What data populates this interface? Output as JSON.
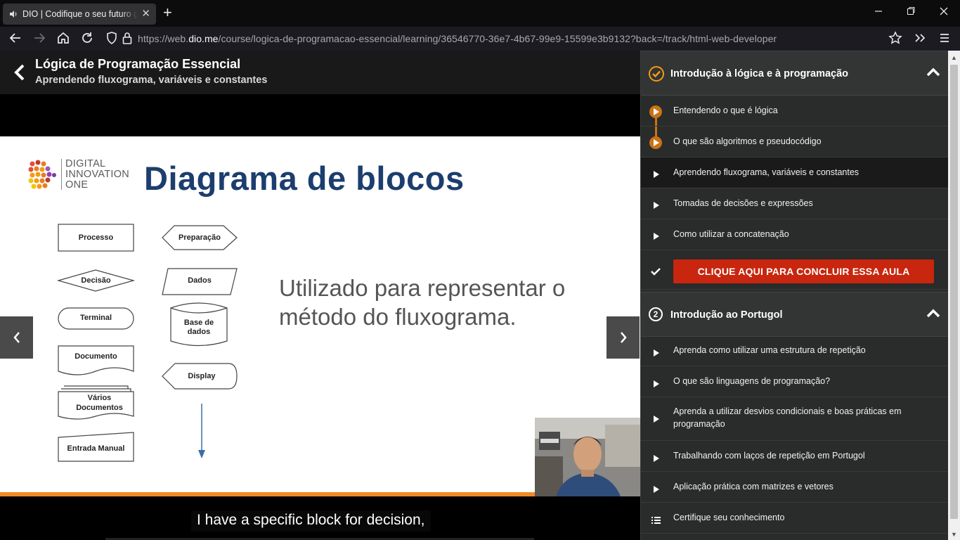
{
  "browser": {
    "tab_title": "DIO | Codifique o seu futuro global agora",
    "url_prefix": "https://web.",
    "url_domain": "dio.me",
    "url_rest": "/course/logica-de-programacao-essencial/learning/36546770-36e7-4b67-99e9-15599e3b9132?back=/track/html-web-developer"
  },
  "course": {
    "title": "Lógica de Programação Essencial",
    "subtitle": "Aprendendo fluxograma, variáveis e constantes"
  },
  "slide": {
    "logo_line1": "DIGITAL",
    "logo_line2": "INNOVATION",
    "logo_line3": "ONE",
    "heading": "Diagrama de blocos",
    "text_line1": "Utilizado para representar o",
    "text_line2": "método do fluxograma.",
    "blocks": {
      "processo": "Processo",
      "decisao": "Decisão",
      "terminal": "Terminal",
      "documento": "Documento",
      "varios1": "Vários",
      "varios2": "Documentos",
      "entrada": "Entrada Manual",
      "preparacao": "Preparação",
      "dados": "Dados",
      "base1": "Base de",
      "base2": "dados",
      "display": "Display"
    }
  },
  "caption": "I have a specific block for decision,",
  "sidebar": {
    "section1": {
      "title": "Introdução à lógica e à programação",
      "lessons": [
        "Entendendo o que é lógica",
        "O que são algoritmos e pseudocódigo",
        "Aprendendo fluxograma, variáveis e constantes",
        "Tomadas de decisões e expressões",
        "Como utilizar a concatenação"
      ],
      "conclude_label": "CLIQUE AQUI PARA CONCLUIR ESSA AULA"
    },
    "section2": {
      "number": "2",
      "title": "Introdução ao Portugol",
      "lessons": [
        "Aprenda como utilizar uma estrutura de repetição",
        "O que são linguagens de programação?",
        "Aprenda a utilizar desvios condicionais e boas práticas em",
        "programação",
        "Trabalhando com laços de repetição em Portugol",
        "Aplicação prática com matrizes e vetores",
        "Certifique seu conhecimento"
      ]
    }
  },
  "colors": {
    "accent_orange": "#c97316",
    "conclude_red": "#c8260e",
    "slide_heading": "#1c3e6e"
  }
}
